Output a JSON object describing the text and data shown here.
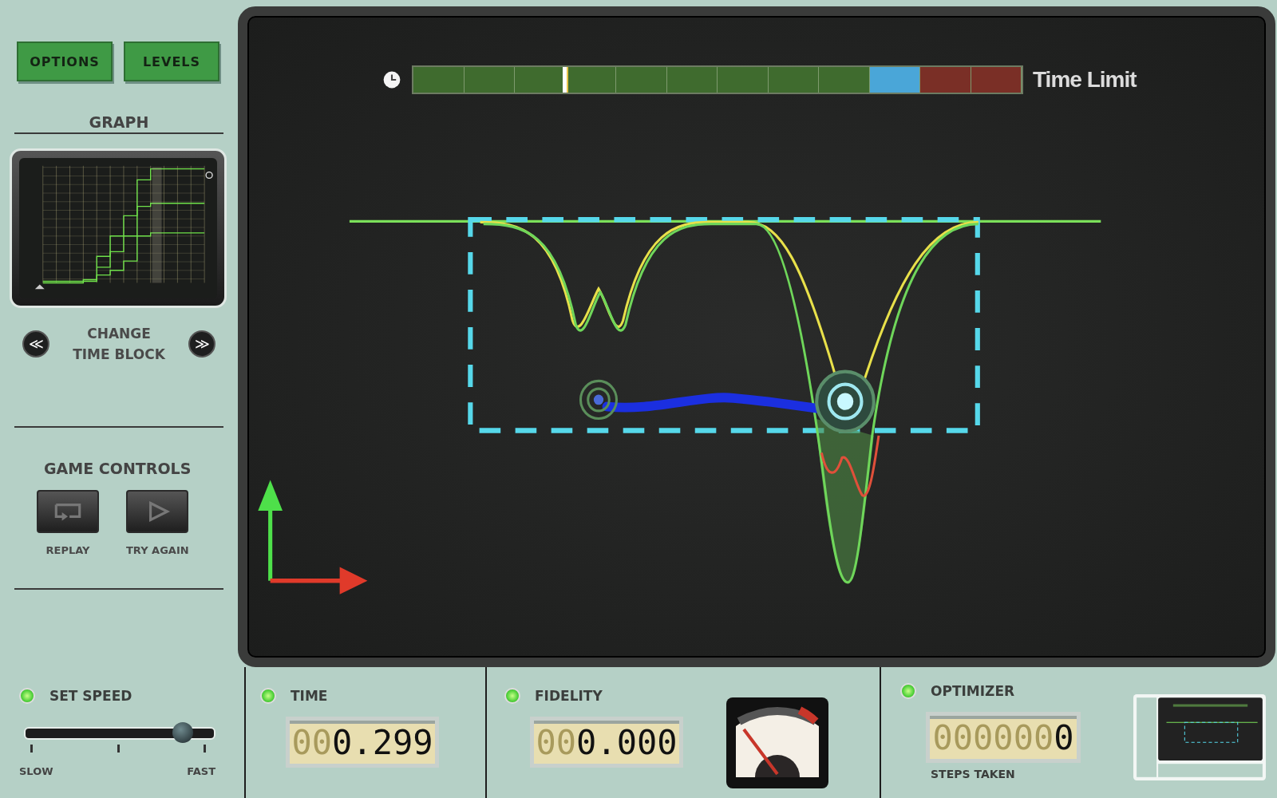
{
  "menu_buttons": [
    "OPTIONS",
    "LEVELS"
  ],
  "graph": {
    "title": "GRAPH"
  },
  "time_block": {
    "lines": [
      "CHANGE",
      "TIME BLOCK"
    ],
    "prev": "≪",
    "next": "≫"
  },
  "game_controls": {
    "title": "GAME CONTROLS",
    "buttons": [
      {
        "kind": "replay",
        "label": "REPLAY"
      },
      {
        "kind": "play",
        "label": "TRY AGAIN"
      }
    ]
  },
  "timeline": {
    "level": 0.246,
    "label": "Time Limit",
    "segments": [
      {
        "color": "#3f6b2e"
      },
      {
        "color": "#3f6b2e"
      },
      {
        "color": "#3f6b2e"
      },
      {
        "color": "#3f6b2e"
      },
      {
        "color": "#3f6b2e"
      },
      {
        "color": "#3f6b2e"
      },
      {
        "color": "#3f6b2e"
      },
      {
        "color": "#3f6b2e"
      },
      {
        "color": "#3f6b2e"
      },
      {
        "color": "#4aa6d8"
      },
      {
        "color": "#7a2f26"
      },
      {
        "color": "#7a2f26"
      }
    ]
  },
  "speed": {
    "label": "SET SPEED",
    "on": true,
    "level": 0.83,
    "min_label": "SLOW",
    "max_label": "FAST"
  },
  "time": {
    "label": "TIME",
    "on": true,
    "ghost": "00",
    "value": "0.299"
  },
  "fidelity": {
    "label": "FIDELITY",
    "on": true,
    "ghost": "00",
    "value": "0.000"
  },
  "optimizer": {
    "label": "OPTIMIZER",
    "on": true,
    "ghost": "000000",
    "value": "0",
    "caption": "STEPS TAKEN"
  }
}
